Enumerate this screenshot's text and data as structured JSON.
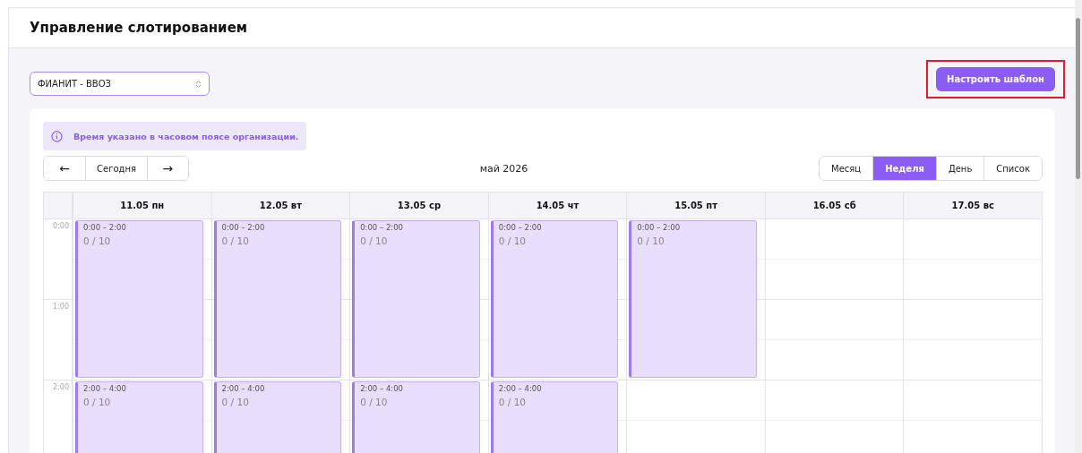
{
  "page_title": "Управление слотированием",
  "warehouse_select": {
    "value": "ФИАНИТ - ВВОЗ"
  },
  "template_button": "Настроить шаблон",
  "info_banner": "Время указано в часовом поясе организации.",
  "nav": {
    "prev": "←",
    "today": "Сегодня",
    "next": "→"
  },
  "period": "май 2026",
  "views": [
    {
      "label": "Месяц",
      "selected": false
    },
    {
      "label": "Неделя",
      "selected": true
    },
    {
      "label": "День",
      "selected": false
    },
    {
      "label": "Список",
      "selected": false
    }
  ],
  "hours": [
    "0:00",
    "1:00",
    "2:00"
  ],
  "days": [
    {
      "label": "11.05 пн",
      "slots": [
        {
          "time": "0:00 – 2:00",
          "count": "0 / 10"
        },
        {
          "time": "2:00 – 4:00",
          "count": "0 / 10"
        }
      ]
    },
    {
      "label": "12.05 вт",
      "slots": [
        {
          "time": "0:00 – 2:00",
          "count": "0 / 10"
        },
        {
          "time": "2:00 – 4:00",
          "count": "0 / 10"
        }
      ]
    },
    {
      "label": "13.05 ср",
      "slots": [
        {
          "time": "0:00 – 2:00",
          "count": "0 / 10"
        },
        {
          "time": "2:00 – 4:00",
          "count": "0 / 10"
        }
      ]
    },
    {
      "label": "14.05 чт",
      "slots": [
        {
          "time": "0:00 – 2:00",
          "count": "0 / 10"
        },
        {
          "time": "2:00 – 4:00",
          "count": "0 / 10"
        }
      ]
    },
    {
      "label": "15.05 пт",
      "slots": [
        {
          "time": "0:00 – 2:00",
          "count": "0 / 10"
        }
      ]
    },
    {
      "label": "16.05 сб"
    },
    {
      "label": "17.05 вс"
    }
  ]
}
